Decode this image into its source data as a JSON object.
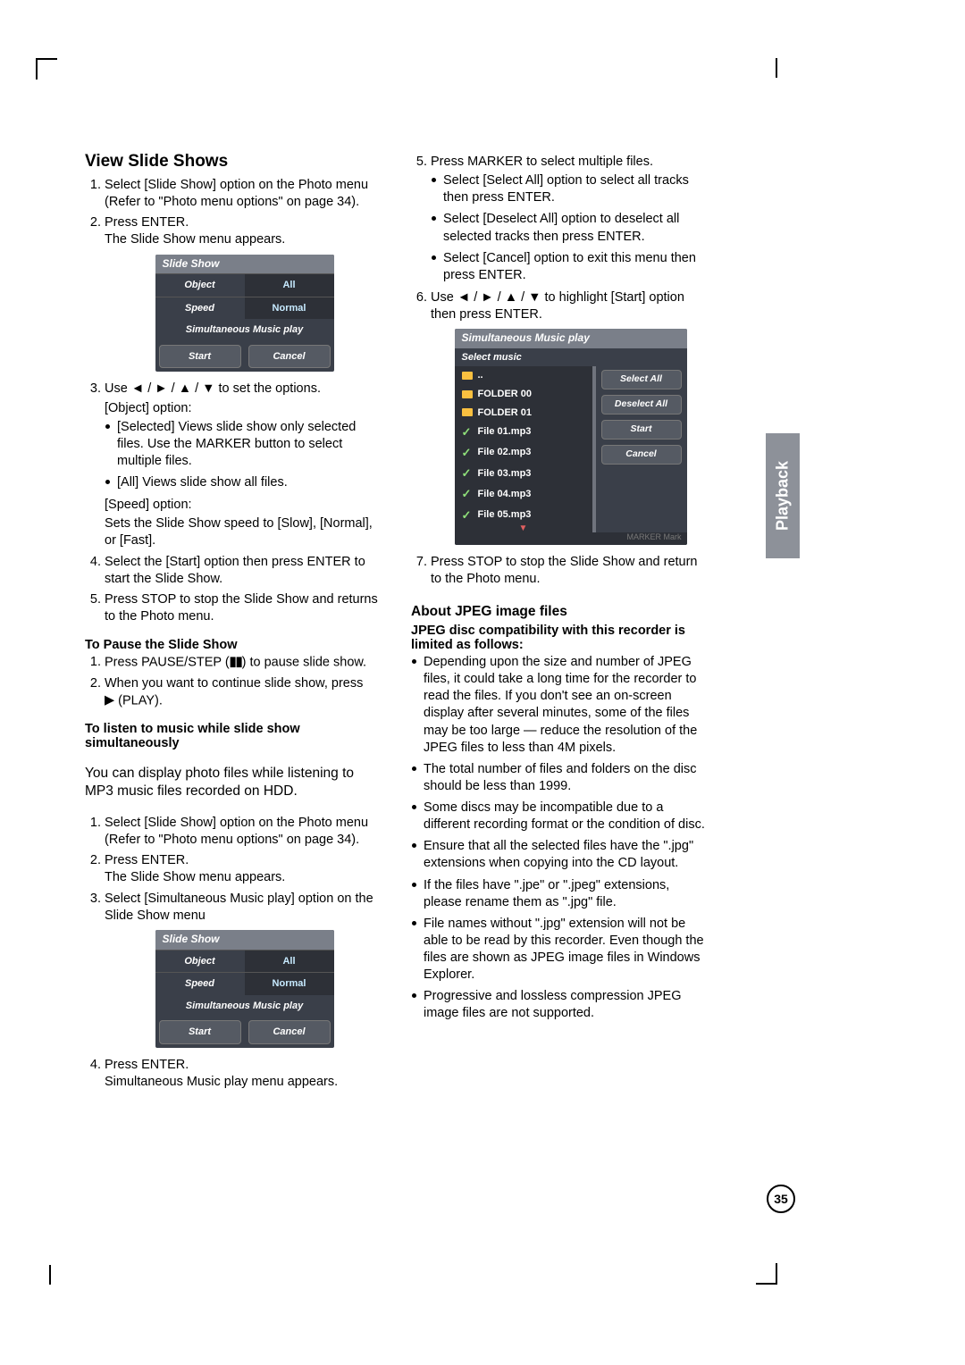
{
  "sideTab": "Playback",
  "pageNumber": "35",
  "left": {
    "h1": "View Slide Shows",
    "s1_1": "Select [Slide Show] option on the Photo menu (Refer to \"Photo menu options\" on page 34).",
    "s1_2a": "Press ENTER.",
    "s1_2b": "The Slide Show menu appears.",
    "osd1": {
      "title": "Slide Show",
      "objectLab": "Object",
      "objectVal": "All",
      "speedLab": "Speed",
      "speedVal": "Normal",
      "mid": "Simultaneous Music play",
      "start": "Start",
      "cancel": "Cancel"
    },
    "s1_3a": "Use ◄ / ► / ▲ / ▼ to set the options.",
    "s1_3b": "[Object] option:",
    "s1_3_b1": "[Selected] Views slide show only selected files. Use the MARKER button to select multiple files.",
    "s1_3_b2": "[All] Views slide show all files.",
    "s1_3c": "[Speed] option:",
    "s1_3d": "Sets the Slide Show speed to [Slow], [Normal], or [Fast].",
    "s1_4": "Select the [Start] option then press ENTER to start the Slide Show.",
    "s1_5": "Press STOP to stop the Slide Show and returns to the Photo menu.",
    "pauseHead": "To Pause the Slide Show",
    "p1": "Press PAUSE/STEP (",
    "p1b": ") to pause slide show.",
    "p2a": "When you want to continue slide show, press",
    "p2b": " (PLAY).",
    "listenHead": "To listen to music while slide show simultaneously",
    "listenPara": "You can display photo files while listening to MP3 music files recorded on HDD.",
    "l1": "Select [Slide Show] option on the Photo menu (Refer to \"Photo menu options\" on page 34).",
    "l2a": "Press ENTER.",
    "l2b": "The Slide Show menu appears.",
    "l3": "Select [Simultaneous Music play] option on the Slide Show menu",
    "l4a": "Press ENTER.",
    "l4b": "Simultaneous Music play menu appears."
  },
  "right": {
    "r5": "Press MARKER to select multiple files.",
    "r5_b1": "Select [Select All] option to select all tracks then press ENTER.",
    "r5_b2": "Select [Deselect All] option to deselect all selected tracks then press ENTER.",
    "r5_b3": "Select [Cancel] option to exit this menu then press ENTER.",
    "r6": "Use ◄ / ► / ▲ / ▼ to highlight [Start] option then press ENTER.",
    "osd2": {
      "title": "Simultaneous Music play",
      "subtitle": "Select  music",
      "items": [
        "..",
        "FOLDER 00",
        "FOLDER 01",
        "File 01.mp3",
        "File 02.mp3",
        "File 03.mp3",
        "File 04.mp3",
        "File 05.mp3"
      ],
      "btns": [
        "Select All",
        "Deselect All",
        "Start",
        "Cancel"
      ],
      "foot": "MARKER Mark"
    },
    "r7": "Press STOP to stop the Slide Show and return to the Photo menu.",
    "h2": "About JPEG image files",
    "h2sub": "JPEG disc compatibility with this recorder is limited as follows:",
    "jb1": "Depending upon the size and number of JPEG files, it could take a long time for the recorder to read the files. If you don't see an on-screen display after several minutes, some of the files may be too large — reduce the resolution of the JPEG files to less than 4M pixels.",
    "jb2": "The total number of files and folders on the disc should be less than 1999.",
    "jb3": "Some discs may be incompatible due to a different recording format or the condition of disc.",
    "jb4": "Ensure that all the selected files have the \".jpg\" extensions when copying into the CD layout.",
    "jb5": "If the files have \".jpe\" or \".jpeg\" extensions, please rename them as \".jpg\" file.",
    "jb6": "File names without \".jpg\" extension will not be able to be read by this recorder. Even though the files are shown as JPEG image files in Windows Explorer.",
    "jb7": "Progressive and lossless compression JPEG image files are not supported."
  }
}
